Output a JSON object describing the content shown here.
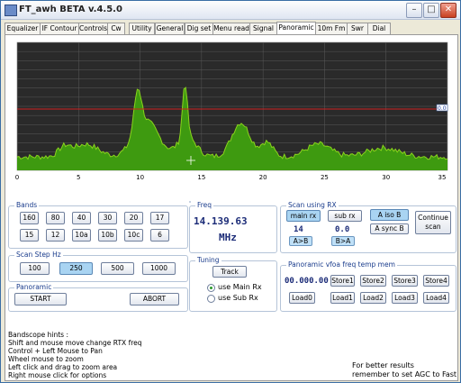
{
  "window": {
    "title": "FT_awh BETA v.4.5.0"
  },
  "window_controls": {
    "minimize": "–",
    "maximize": "□",
    "close": "✕"
  },
  "tabs": [
    "Equalizer",
    "IF Contour",
    "Controls",
    "Cw",
    "Utility",
    "General",
    "Dig set",
    "Menu read",
    "Signal",
    "Panoramic",
    "10m Fm",
    "Swr",
    "Dial"
  ],
  "active_tab": "Panoramic",
  "chart_data": {
    "type": "area",
    "x_ticks": [
      "0",
      "5",
      "10",
      "15",
      "20",
      "25",
      "30",
      "35"
    ],
    "xlim": [
      0,
      35
    ],
    "grid": true,
    "marker_label": "0.0",
    "colors": {
      "background": "#2a2a2a",
      "grid": "#5a5a5a",
      "trace": "#8ad41c",
      "fill": "#3e9a10",
      "threshold": "#d02020"
    }
  },
  "bands": {
    "title": "Bands",
    "buttons": [
      "160",
      "80",
      "40",
      "30",
      "20",
      "17",
      "15",
      "12",
      "10a",
      "10b",
      "10c",
      "6"
    ]
  },
  "freq": {
    "title": "Freq",
    "value": "14.139.63",
    "unit": "MHz"
  },
  "scan_rx": {
    "title": "Scan using RX",
    "main_rx": "main rx",
    "sub_rx": "sub rx",
    "a_iso_b": "A iso B",
    "a_sync_b": "A sync B",
    "continue_scan_1": "Continue",
    "continue_scan_2": "scan",
    "left_value": "14",
    "right_value": "0.0",
    "a_to_b": "A>B",
    "b_to_a": "B>A"
  },
  "scan_step": {
    "title": "Scan Step Hz",
    "buttons": [
      "100",
      "250",
      "500",
      "1000"
    ],
    "selected": "250"
  },
  "tuning": {
    "title": "Tuning",
    "track": "Track",
    "use_main": "use Main Rx",
    "use_sub": "use Sub  Rx"
  },
  "vfo_mem": {
    "title": "Panoramic vfoa freq temp mem",
    "display": "00.000.00",
    "stores": [
      "Store1",
      "Store2",
      "Store3",
      "Store4"
    ],
    "loads": [
      "Load0",
      "Load1",
      "Load2",
      "Load3",
      "Load4"
    ]
  },
  "panoramic": {
    "title": "Panoramic",
    "start": "START",
    "abort": "ABORT"
  },
  "hints": [
    "Bandscope hints :",
    "Shift and mouse move change RTX freq",
    "Control + Left Mouse to Pan",
    "Wheel mouse to zoom",
    "Left click and drag to zoom area",
    "Right mouse click for options"
  ],
  "footer": {
    "line1": "For better results",
    "line2": "remember to set AGC to Fast"
  }
}
